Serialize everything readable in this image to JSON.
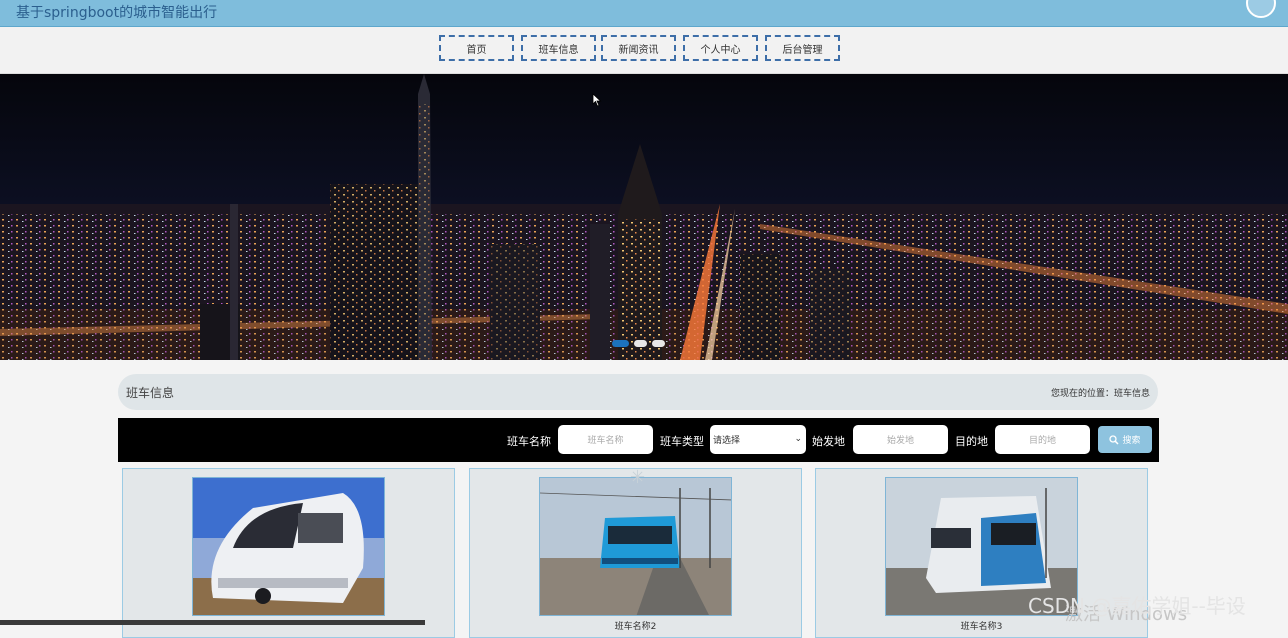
{
  "header": {
    "title": "基于springboot的城市智能出行"
  },
  "nav": [
    {
      "label": "首页"
    },
    {
      "label": "班车信息"
    },
    {
      "label": "新闻资讯"
    },
    {
      "label": "个人中心"
    },
    {
      "label": "后台管理"
    }
  ],
  "banner": {
    "slide_count": 3,
    "active_slide": 1
  },
  "breadcrumb": {
    "title": "班车信息",
    "location": "您现在的位置：班车信息"
  },
  "search": {
    "name_label": "班车名称",
    "name_placeholder": "班车名称",
    "type_label": "班车类型",
    "type_selected": "请选择",
    "origin_label": "始发地",
    "origin_placeholder": "始发地",
    "dest_label": "目的地",
    "dest_placeholder": "目的地",
    "button_label": "搜索"
  },
  "cards": [
    {
      "name": ""
    },
    {
      "name": "班车名称2"
    },
    {
      "name": "班车名称3"
    }
  ],
  "watermarks": {
    "csdn": "CSDN @嘉佑学姐--毕设",
    "windows": "激活 Windows"
  },
  "colors": {
    "topbar": "#7fbddc",
    "nav_border": "#3d6ea8",
    "search_bg": "#000000",
    "search_button": "#8ec3df"
  }
}
